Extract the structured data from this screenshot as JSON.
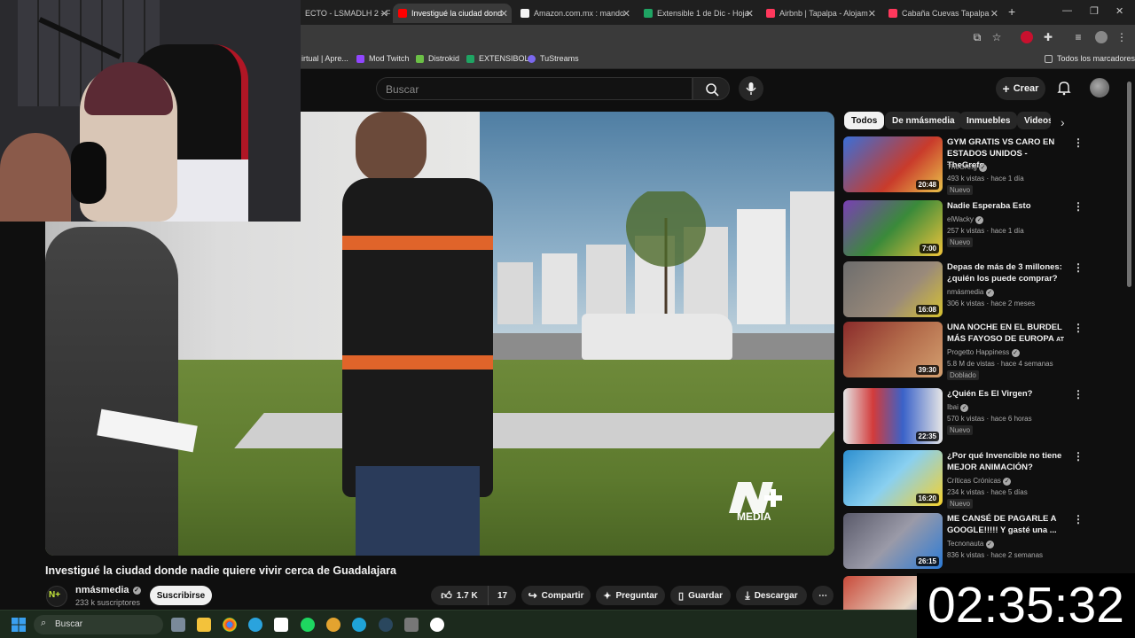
{
  "browser": {
    "tabs": [
      {
        "label": "ECTO - LSMADLH 2 - F",
        "favicon_color": "#4a8af4",
        "active": false
      },
      {
        "label": "Investigué la ciudad dond",
        "favicon_color": "#ff0000",
        "active": true
      },
      {
        "label": "Amazon.com.mx : mando",
        "favicon_color": "#f2f2f2",
        "active": false
      },
      {
        "label": "Extensible 1 de Dic - Hoja",
        "favicon_color": "#1fa463",
        "active": false
      },
      {
        "label": "Airbnb | Tapalpa - Alojam",
        "favicon_color": "#ff385c",
        "active": false
      },
      {
        "label": "Cabaña Cuevas Tapalpa",
        "favicon_color": "#ff385c",
        "active": false
      }
    ],
    "new_tab_glyph": "+",
    "bookmarks": [
      {
        "label": "irtual | Apre...",
        "icon_color": "#888888"
      },
      {
        "label": "Mod Twitch",
        "icon_color": "#9146ff"
      },
      {
        "label": "Distrokid",
        "icon_color": "#6bc046"
      },
      {
        "label": "EXTENSIBOL",
        "icon_color": "#1fa463"
      },
      {
        "label": "TuStreams",
        "icon_color": "#7b68ee"
      }
    ],
    "all_bookmarks_label": "Todos los marcadores"
  },
  "youtube": {
    "search_placeholder": "Buscar",
    "create_label": "Crear",
    "video": {
      "title": "Investigué la ciudad donde nadie quiere vivir cerca de Guadalajara",
      "watermark": "MEDIA"
    },
    "channel": {
      "name": "nmásmedia",
      "subscribers": "233 k suscriptores",
      "avatar_text": "N+",
      "subscribe_label": "Suscribirse"
    },
    "actions": {
      "likes": "1.7 K",
      "dislikes": "17",
      "share": "Compartir",
      "ask": "Preguntar",
      "save": "Guardar",
      "download": "Descargar"
    },
    "chips": [
      "Todos",
      "De nmásmedia",
      "Inmuebles",
      "Videos"
    ],
    "recommendations": [
      {
        "title": "GYM GRATIS VS CARO EN ESTADOS UNIDOS - TheGrefg",
        "channel": "TheGrefg",
        "meta": "493 k vistas · hace 1 día",
        "badge": "Nuevo",
        "duration": "20:48",
        "thumb_colors": [
          "#3a6fd8",
          "#c93b2b"
        ]
      },
      {
        "title": "Nadie Esperaba Esto",
        "channel": "elWacky",
        "meta": "257 k vistas · hace 1 día",
        "badge": "Nuevo",
        "duration": "7:00",
        "thumb_colors": [
          "#7a3fb5",
          "#f0c43a"
        ]
      },
      {
        "title": "Depas de más de 3 millones: ¿quién los puede comprar?",
        "channel": "nmásmedia",
        "meta": "306 k vistas · hace 2 meses",
        "badge": "",
        "duration": "16:08",
        "thumb_colors": [
          "#6d6d6d",
          "#d7c230"
        ]
      },
      {
        "title": "UNA NOCHE EN EL BURDEL MÁS FAYOSO DE EUROPA",
        "channel": "Progetto Happiness",
        "meta": "5.8 M de vistas · hace 4 semanas",
        "badge": "Doblado",
        "duration": "39:30",
        "thumb_colors": [
          "#8a2b2b",
          "#d4a070"
        ]
      },
      {
        "title": "¿Quién Es El Virgen?",
        "channel": "Ibai",
        "meta": "570 k vistas · hace 6 horas",
        "badge": "Nuevo",
        "duration": "22:35",
        "thumb_colors": [
          "#e5e5e5",
          "#d23b3b"
        ]
      },
      {
        "title": "¿Por qué Invencible no tiene MEJOR ANIMACIÓN?",
        "channel": "Críticas Crónicas",
        "meta": "234 k vistas · hace 5 días",
        "badge": "Nuevo",
        "duration": "16:20",
        "thumb_colors": [
          "#2d8fd0",
          "#f5d12b"
        ]
      },
      {
        "title": "ME CANSÉ DE PAGARLE A GOOGLE!!!!! Y gasté una ...",
        "channel": "Tecnonauta",
        "meta": "836 k vistas · hace 2 semanas",
        "badge": "",
        "duration": "26:15",
        "thumb_colors": [
          "#5a5a6a",
          "#2c7bd6"
        ]
      }
    ],
    "rec_suffix_4": "AT"
  },
  "overlay": {
    "timer": "02:35:32"
  },
  "taskbar": {
    "search_label": "Buscar",
    "apps": [
      {
        "name": "file-explorer-app-icon",
        "color": "#f3c23b"
      },
      {
        "name": "chrome-app-icon",
        "color": "#4285f4"
      },
      {
        "name": "telegram-app-icon",
        "color": "#2aa3dd"
      },
      {
        "name": "capcut-app-icon",
        "color": "#ffffff"
      },
      {
        "name": "spotify-app-icon",
        "color": "#1ed760"
      },
      {
        "name": "chrome-canary-app-icon",
        "color": "#e3a32f"
      },
      {
        "name": "edge-app-icon",
        "color": "#1fa3d8"
      },
      {
        "name": "steam-app-icon",
        "color": "#2a475e"
      },
      {
        "name": "calculator-app-icon",
        "color": "#777777"
      },
      {
        "name": "github-desktop-app-icon",
        "color": "#ffffff"
      }
    ]
  }
}
